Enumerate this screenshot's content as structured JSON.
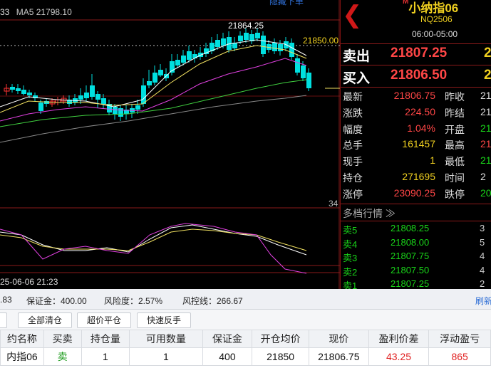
{
  "chart": {
    "ma_legend": [
      {
        "text": "33",
        "color": "#e0e0e0"
      },
      {
        "text": "MA5 21798.10",
        "color": "#c8c8c8"
      }
    ],
    "hide_label": "隐藏下单",
    "high_label": "21864.25",
    "ref_price_label": "21850.00",
    "date_label": "25-06-06 21:23",
    "sub_axis_label": "34",
    "colors": {
      "up": "#ff3333",
      "down": "#00e0e0",
      "ma1": "#ffffff",
      "ma2": "#f0e060",
      "ma3": "#e040e0",
      "ma4": "#40d040",
      "ma5": "#888888"
    }
  },
  "panel": {
    "back_icon": "back-arrow-icon",
    "title_mark": "M",
    "title": "小纳指06",
    "code": "NQ2506",
    "hours": "06:00-05:00",
    "sell_label": "卖出",
    "sell_price": "21807.25",
    "sell_extra": "2",
    "buy_label": "买入",
    "buy_price": "21806.50",
    "buy_extra": "2",
    "stats": [
      {
        "l": "最新",
        "v": "21806.75",
        "vc": "#ff4646",
        "r": "昨收",
        "rv": "21",
        "rvc": "#ddd"
      },
      {
        "l": "涨跌",
        "v": "224.50",
        "vc": "#ff4646",
        "r": "昨结",
        "rv": "21",
        "rvc": "#ddd"
      },
      {
        "l": "幅度",
        "v": "1.04%",
        "vc": "#ff4646",
        "r": "开盘",
        "rv": "21",
        "rvc": "#19d419"
      },
      {
        "l": "总手",
        "v": "161457",
        "vc": "#f0d020",
        "r": "最高",
        "rv": "21",
        "rvc": "#ff4646"
      },
      {
        "l": "现手",
        "v": "1",
        "vc": "#f0d020",
        "r": "最低",
        "rv": "21",
        "rvc": "#19d419"
      },
      {
        "l": "持仓",
        "v": "271695",
        "vc": "#f0d020",
        "r": "时间",
        "rv": "2",
        "rvc": "#ddd"
      },
      {
        "l": "涨停",
        "v": "23090.25",
        "vc": "#ff4646",
        "r": "跌停",
        "rv": "20",
        "rvc": "#19d419"
      }
    ],
    "depth_title": "多档行情 ≫",
    "depth": [
      {
        "l": "卖5",
        "p": "21808.25",
        "v": "3"
      },
      {
        "l": "卖4",
        "p": "21808.00",
        "v": "5"
      },
      {
        "l": "卖3",
        "p": "21807.75",
        "v": "4"
      },
      {
        "l": "卖2",
        "p": "21807.50",
        "v": "4"
      },
      {
        "l": "卖1",
        "p": "21807.25",
        "v": "2"
      }
    ]
  },
  "info": {
    "balance": ".83",
    "margin": "保证金：400.00",
    "risk": "风险度：2.57%",
    "risk_line": "风控线：266.67",
    "refresh": "刷新"
  },
  "buttons": [
    "",
    "全部清仓",
    "超价平仓",
    "快速反手"
  ],
  "table": {
    "headers": [
      "约名称",
      "买卖",
      "持仓量",
      "可用数量",
      "保证金",
      "开仓均价",
      "现价",
      "盈利价差",
      "浮动盈亏"
    ],
    "row": [
      "内指06",
      "卖",
      "1",
      "1",
      "400",
      "21850",
      "21806.75",
      "43.25",
      "865"
    ]
  }
}
